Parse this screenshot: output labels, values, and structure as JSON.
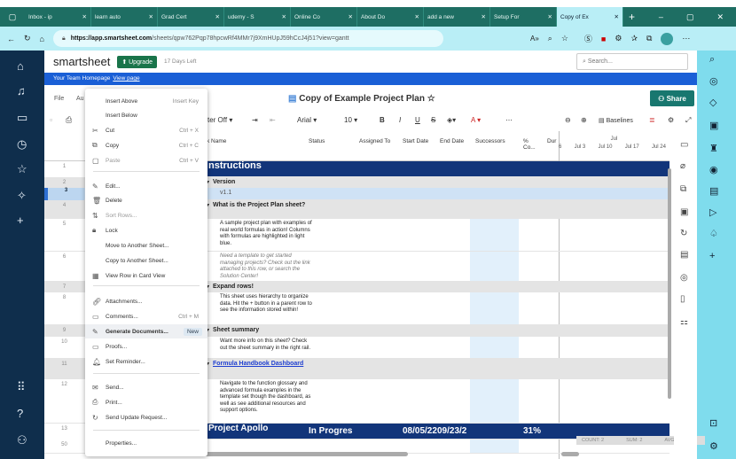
{
  "browser": {
    "tabs": [
      "Inbox - ip",
      "learn auto",
      "Grad Cert",
      "udemy - S",
      "Online Co",
      "About Do",
      "add a new",
      "Setup For",
      "Copy of Ex"
    ],
    "active_tab": 8,
    "url_host": "https://app.smartsheet.com",
    "url_path": "/sheets/qpw762Pqp78hpcwRf4MMr7j9XmHUpJ59hCcJ4j51?view=gantt"
  },
  "app": {
    "logo": "smartsheet",
    "upgrade": "Upgrade",
    "trial": "17 Days Left",
    "search_placeholder": "Search...",
    "banner_text": "Your Team Homepage",
    "banner_link": "View page"
  },
  "sheet": {
    "title": "Copy of Example Project Plan",
    "share": "Share",
    "menu_file": "File",
    "menu_au": "Au",
    "filter": "ter Off",
    "font": "Arial",
    "size": "10",
    "baselines": "Baselines"
  },
  "columns": {
    "task": "k Name",
    "status": "Status",
    "assigned": "Assigned To",
    "start": "Start Date",
    "end": "End Date",
    "successors": "Successors",
    "pct": "% Co...",
    "dur": "Dur",
    "gantt_month": "Jul",
    "gantt_weeks": [
      "6",
      "Jul 3",
      "Jul 10",
      "Jul 17",
      "Jul 24"
    ]
  },
  "rows": [
    {
      "n": "1",
      "task": "nstructions"
    },
    {
      "n": "2",
      "task": "Version"
    },
    {
      "n": "3",
      "task": "v1.1"
    },
    {
      "n": "4",
      "task": "What is the Project Plan sheet?"
    },
    {
      "n": "5",
      "task": "A sample project plan with examples of real world formulas in action! Columns with formulas are highlighted in light blue."
    },
    {
      "n": "6",
      "task": "Need a template to get started managing projects? Check out the link attached to this row, or search the Solution Center!"
    },
    {
      "n": "7",
      "task": "Expand rows!"
    },
    {
      "n": "8",
      "task": "This sheet uses hierarchy to organize data. Hit the + button in a parent row to see the information stored within!"
    },
    {
      "n": "9",
      "task": "Sheet summary"
    },
    {
      "n": "10",
      "task": "Want more info on this sheet? Check out the sheet summary in the right rail."
    },
    {
      "n": "11",
      "task": "Formula Handbook Dashboard"
    },
    {
      "n": "12",
      "task": "Navigate to the function glossary and advanced formula examples in the template set though the dashboard, as well as see additional resources and support options."
    },
    {
      "n": "13",
      "task": "Project Apollo",
      "status": "In Progres",
      "start": "08/05/22",
      "end": "09/23/2",
      "pct": "31%"
    },
    {
      "n": "50",
      "task": ""
    }
  ],
  "summary": {
    "count": "COUNT: 2",
    "sum": "SUM: 2",
    "avg": "AVG: 2"
  },
  "context_menu": [
    {
      "label": "Insert Above",
      "shortcut": "Insert Key"
    },
    {
      "label": "Insert Below"
    },
    {
      "label": "Cut",
      "shortcut": "Ctrl + X"
    },
    {
      "label": "Copy",
      "shortcut": "Ctrl + C"
    },
    {
      "label": "Paste",
      "shortcut": "Ctrl + V"
    },
    {
      "label": "Edit..."
    },
    {
      "label": "Delete"
    },
    {
      "label": "Sort Rows..."
    },
    {
      "label": "Lock"
    },
    {
      "label": "Move to Another Sheet..."
    },
    {
      "label": "Copy to Another Sheet..."
    },
    {
      "label": "View Row in Card View"
    },
    {
      "label": "Attachments..."
    },
    {
      "label": "Comments...",
      "shortcut": "Ctrl + M"
    },
    {
      "label": "Generate Documents...",
      "badge": "New"
    },
    {
      "label": "Proofs..."
    },
    {
      "label": "Set Reminder..."
    },
    {
      "label": "Send..."
    },
    {
      "label": "Print..."
    },
    {
      "label": "Send Update Request..."
    },
    {
      "label": "Properties..."
    }
  ],
  "colors": {
    "navy": "#12357a",
    "banner": "#1a5fd6",
    "share": "#18776f",
    "tabbar": "#1e6e63",
    "leftnav": "#0f2e4c"
  }
}
